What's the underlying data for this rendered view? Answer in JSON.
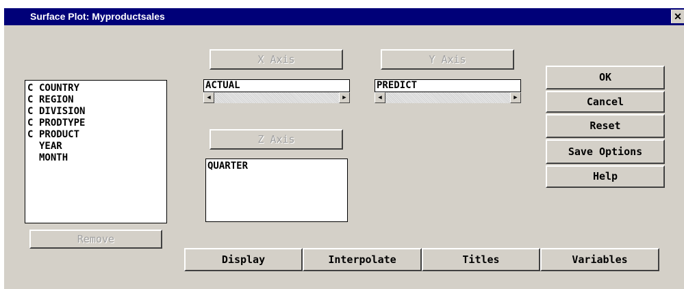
{
  "window": {
    "title": "Surface Plot: Myproductsales",
    "close_glyph": "✕"
  },
  "variables": {
    "items": [
      {
        "flag": "C",
        "name": "COUNTRY"
      },
      {
        "flag": "C",
        "name": "REGION"
      },
      {
        "flag": "C",
        "name": "DIVISION"
      },
      {
        "flag": "C",
        "name": "PRODTYPE"
      },
      {
        "flag": "C",
        "name": "PRODUCT"
      },
      {
        "flag": "",
        "name": "YEAR"
      },
      {
        "flag": "",
        "name": "MONTH"
      }
    ],
    "remove_label": "Remove"
  },
  "axes": {
    "x_label": "X Axis",
    "x_value": "ACTUAL",
    "y_label": "Y Axis",
    "y_value": "PREDICT",
    "z_label": "Z Axis",
    "z_value": "QUARTER"
  },
  "actions": {
    "ok": "OK",
    "cancel": "Cancel",
    "reset": "Reset",
    "save_options": "Save Options",
    "help": "Help"
  },
  "tabs": {
    "display": "Display",
    "interpolate": "Interpolate",
    "titles": "Titles",
    "variables": "Variables"
  },
  "icons": {
    "scroll_left": "◀",
    "scroll_right": "▶"
  }
}
